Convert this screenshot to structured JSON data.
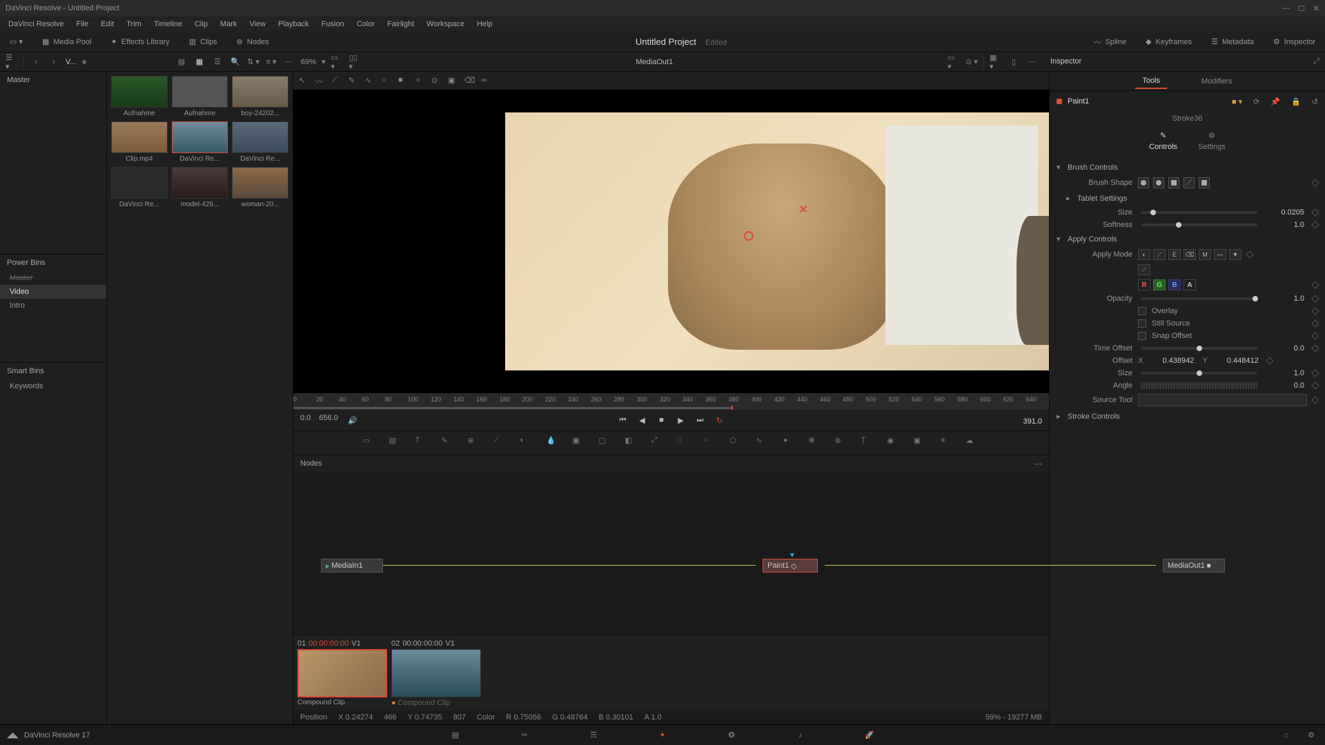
{
  "app": {
    "title": "DaVinci Resolve - Untitled Project"
  },
  "menus": [
    "DaVinci Resolve",
    "File",
    "Edit",
    "Trim",
    "Timeline",
    "Clip",
    "Mark",
    "View",
    "Playback",
    "Fusion",
    "Color",
    "Fairlight",
    "Workspace",
    "Help"
  ],
  "toolbar": {
    "media_pool": "Media Pool",
    "effects_lib": "Effects Library",
    "clips": "Clips",
    "nodes": "Nodes",
    "project_title": "Untitled Project",
    "edited": "Edited",
    "spline": "Spline",
    "keyframes": "Keyframes",
    "metadata": "Metadata",
    "inspector": "Inspector"
  },
  "secondary": {
    "dropdown": "V...",
    "zoom": "69%",
    "viewer_label": "MediaOut1",
    "inspector_label": "Inspector"
  },
  "bins": {
    "master": "Master",
    "power": "Power Bins",
    "master2": "Master",
    "video": "Video",
    "intro": "Intro",
    "smart": "Smart Bins",
    "keywords": "Keywords"
  },
  "thumbs": [
    {
      "label": "Aufnahme"
    },
    {
      "label": "Aufnahme"
    },
    {
      "label": "boy-24202..."
    },
    {
      "label": "Clip.mp4"
    },
    {
      "label": "DaVinci Re..."
    },
    {
      "label": "DaVinci Re..."
    },
    {
      "label": "DaVinci Re..."
    },
    {
      "label": "model-429..."
    },
    {
      "label": "woman-20..."
    }
  ],
  "ruler": [
    "0",
    "20",
    "40",
    "60",
    "80",
    "100",
    "120",
    "140",
    "160",
    "180",
    "200",
    "220",
    "240",
    "260",
    "280",
    "300",
    "320",
    "340",
    "360",
    "380",
    "400",
    "420",
    "440",
    "460",
    "480",
    "500",
    "520",
    "540",
    "560",
    "580",
    "600",
    "620",
    "640"
  ],
  "transport": {
    "start": "0.0",
    "end": "656.0",
    "current": "391.0"
  },
  "nodes_panel": {
    "title": "Nodes",
    "media_in": "MediaIn1",
    "paint": "Paint1",
    "media_out": "MediaOut1"
  },
  "clips": [
    {
      "idx": "01",
      "tc": "00:00:00:00",
      "track": "V1",
      "name": "Compound Clip",
      "active": true
    },
    {
      "idx": "02",
      "tc": "00:00:00:00",
      "track": "V1",
      "name": "Compound Clip",
      "active": false
    }
  ],
  "status": {
    "pos_label": "Position",
    "x_label": "X",
    "x_val": "0.24274",
    "x_px": "466",
    "y_label": "Y",
    "y_val": "0.74735",
    "y_px": "807",
    "color_label": "Color",
    "r_label": "R",
    "r_val": "0.75056",
    "g_label": "G",
    "g_val": "0.48764",
    "b_label": "B",
    "b_val": "0.30101",
    "a_label": "A",
    "a_val": "1.0",
    "mem": "59% - 19277 MB"
  },
  "inspector": {
    "tabs": {
      "tools": "Tools",
      "modifiers": "Modifiers"
    },
    "node_name": "Paint1",
    "stroke": "Stroke36",
    "subtabs": {
      "controls": "Controls",
      "settings": "Settings"
    },
    "sections": {
      "brush": "Brush Controls",
      "brush_shape": "Brush Shape",
      "tablet": "Tablet Settings",
      "size": "Size",
      "size_val": "0.0205",
      "softness": "Softness",
      "softness_val": "1.0",
      "apply": "Apply Controls",
      "apply_mode": "Apply Mode",
      "rgb": {
        "r": "R",
        "g": "G",
        "b": "B",
        "a": "A"
      },
      "opacity": "Opacity",
      "opacity_val": "1.0",
      "overlay": "Overlay",
      "still": "Still Source",
      "snap": "Snap Offset",
      "time_offset": "Time Offset",
      "time_offset_val": "0.0",
      "offset": "Offset",
      "offset_x_label": "X",
      "offset_x": "0.438942",
      "offset_y_label": "Y",
      "offset_y": "0.448412",
      "size2": "Size",
      "size2_val": "1.0",
      "angle": "Angle",
      "angle_val": "0.0",
      "source_tool": "Source Tool",
      "stroke_controls": "Stroke Controls"
    }
  },
  "bottom": {
    "app_name": "DaVinci Resolve 17"
  }
}
